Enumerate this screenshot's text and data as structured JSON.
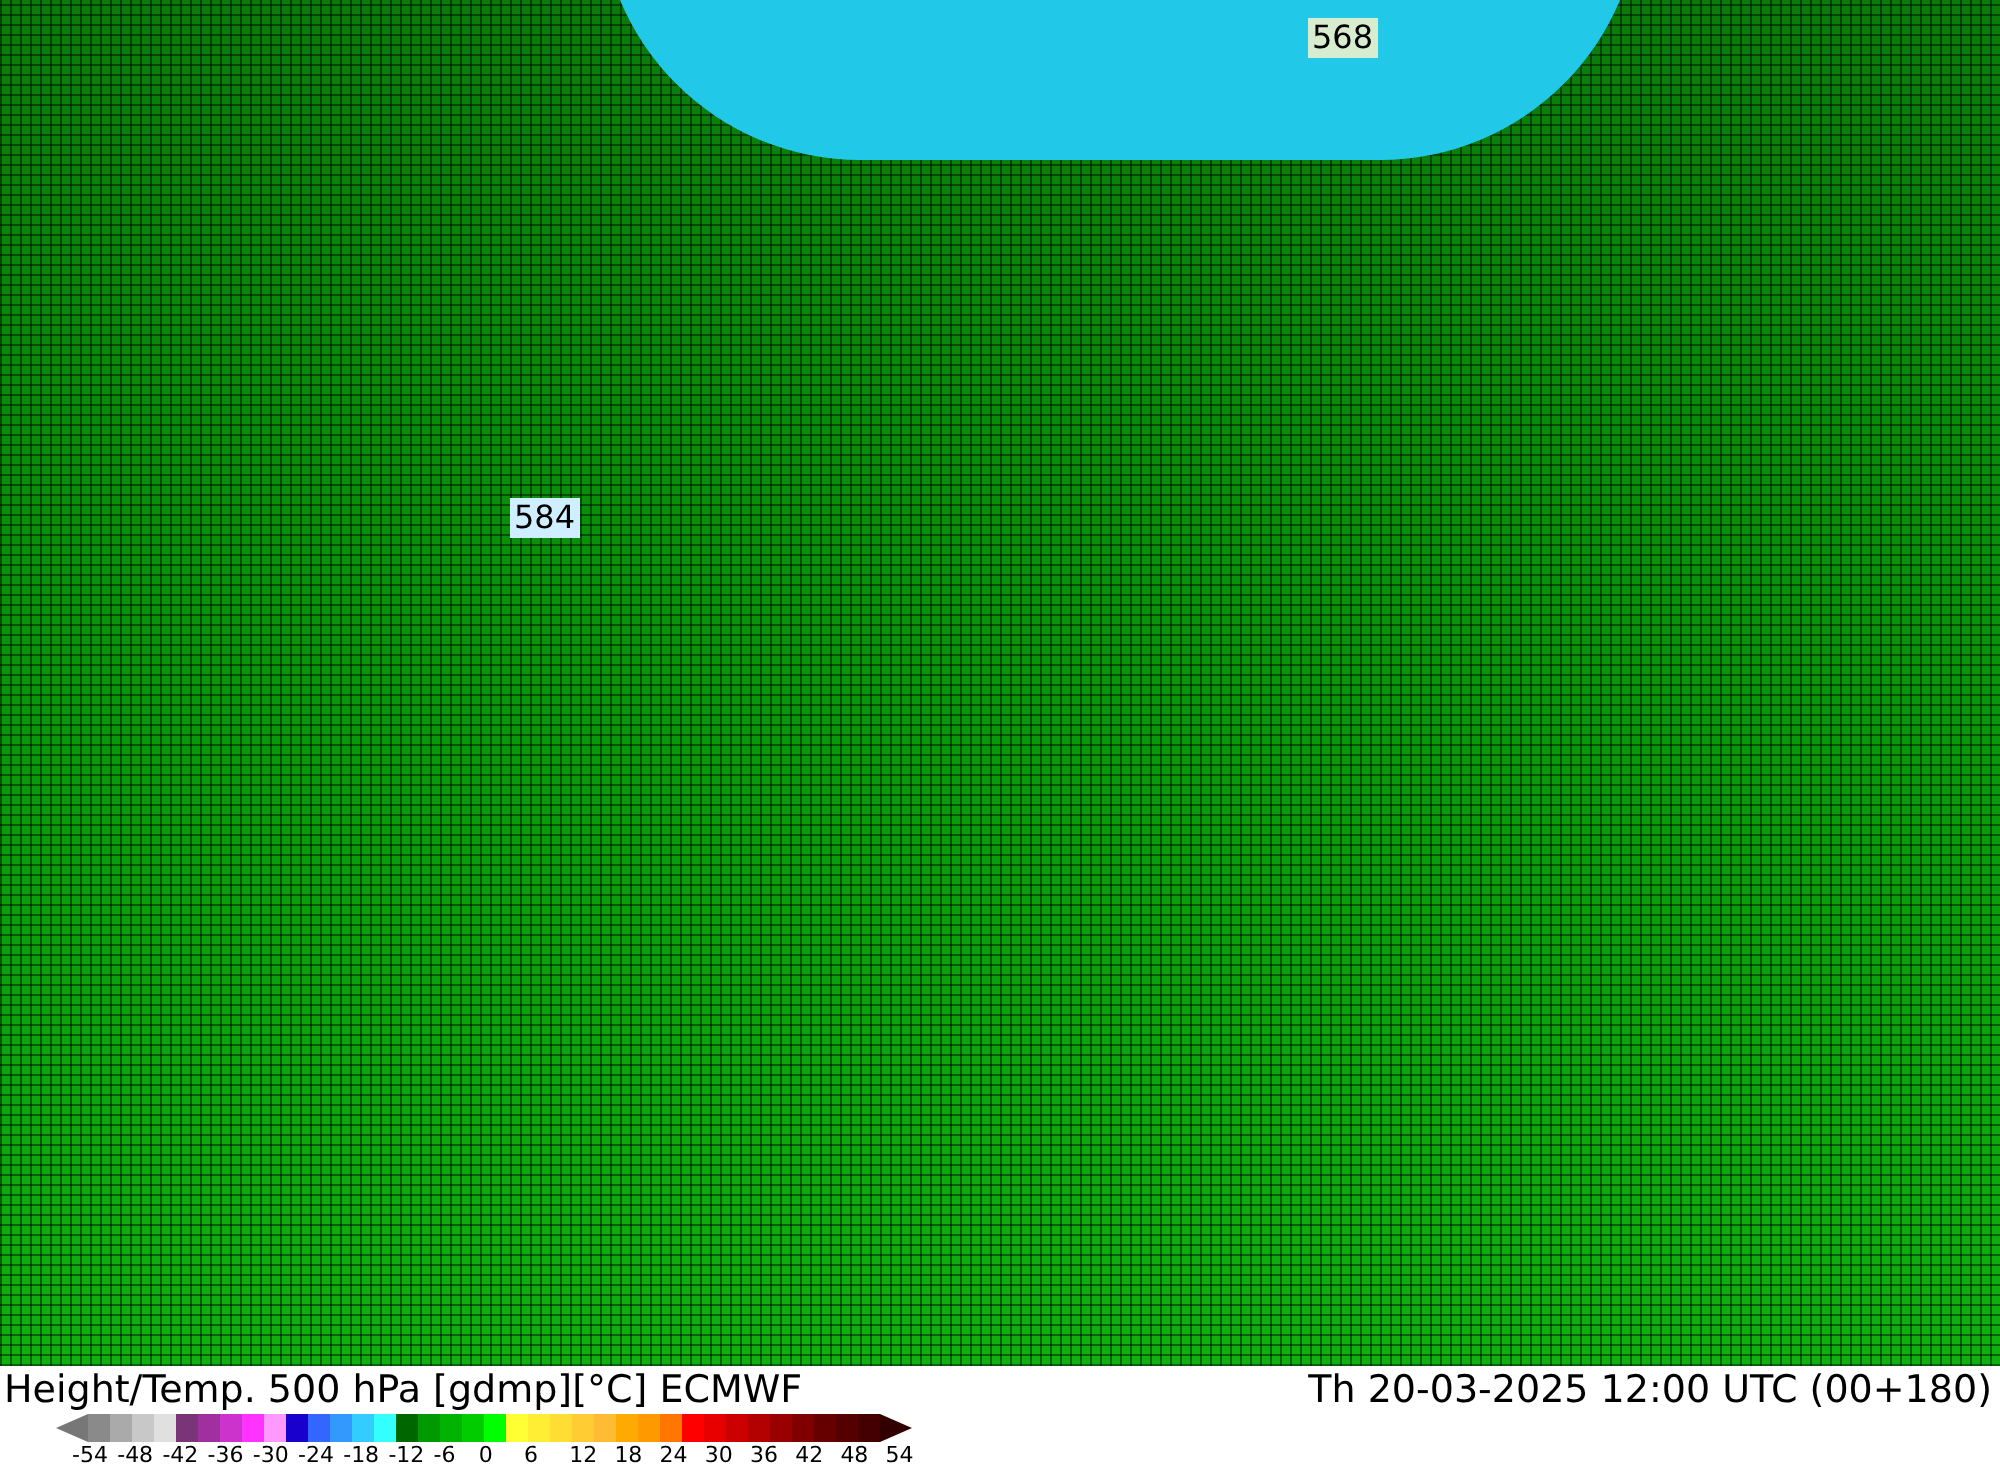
{
  "map": {
    "contour_labels": [
      {
        "text": "568",
        "kind": "cold"
      },
      {
        "text": "584",
        "kind": "mild"
      }
    ]
  },
  "title": "Height/Temp. 500 hPa [gdmp][°C] ECMWF",
  "valid_time": "Th 20-03-2025 12:00 UTC (00+180)",
  "colorbar": {
    "swatches": [
      {
        "color": "#8a8a8a"
      },
      {
        "color": "#aaaaaa"
      },
      {
        "color": "#c8c8c8"
      },
      {
        "color": "#e0e0e0"
      },
      {
        "color": "#7a3478"
      },
      {
        "color": "#a030a0"
      },
      {
        "color": "#cc33cc"
      },
      {
        "color": "#ff33ff"
      },
      {
        "color": "#ff99ff"
      },
      {
        "color": "#1a00cc"
      },
      {
        "color": "#3366ff"
      },
      {
        "color": "#3399ff"
      },
      {
        "color": "#33ccff"
      },
      {
        "color": "#33ffff"
      },
      {
        "color": "#006600"
      },
      {
        "color": "#009900"
      },
      {
        "color": "#00b300"
      },
      {
        "color": "#00cc00"
      },
      {
        "color": "#00ff00"
      },
      {
        "color": "#ffff33"
      },
      {
        "color": "#ffee33"
      },
      {
        "color": "#ffdd33"
      },
      {
        "color": "#ffcc33"
      },
      {
        "color": "#ffbb33"
      },
      {
        "color": "#ffaa00"
      },
      {
        "color": "#ff9900"
      },
      {
        "color": "#ff7700"
      },
      {
        "color": "#ff0000"
      },
      {
        "color": "#e60000"
      },
      {
        "color": "#cc0000"
      },
      {
        "color": "#b30000"
      },
      {
        "color": "#990000"
      },
      {
        "color": "#800000"
      },
      {
        "color": "#660000"
      },
      {
        "color": "#550000"
      },
      {
        "color": "#440000"
      }
    ],
    "ticks": [
      "-54",
      "-48",
      "-42",
      "-36",
      "-30",
      "-24",
      "-18",
      "-12",
      "-6",
      "0",
      "6",
      "12",
      "18",
      "24",
      "30",
      "36",
      "42",
      "48",
      "54"
    ]
  }
}
